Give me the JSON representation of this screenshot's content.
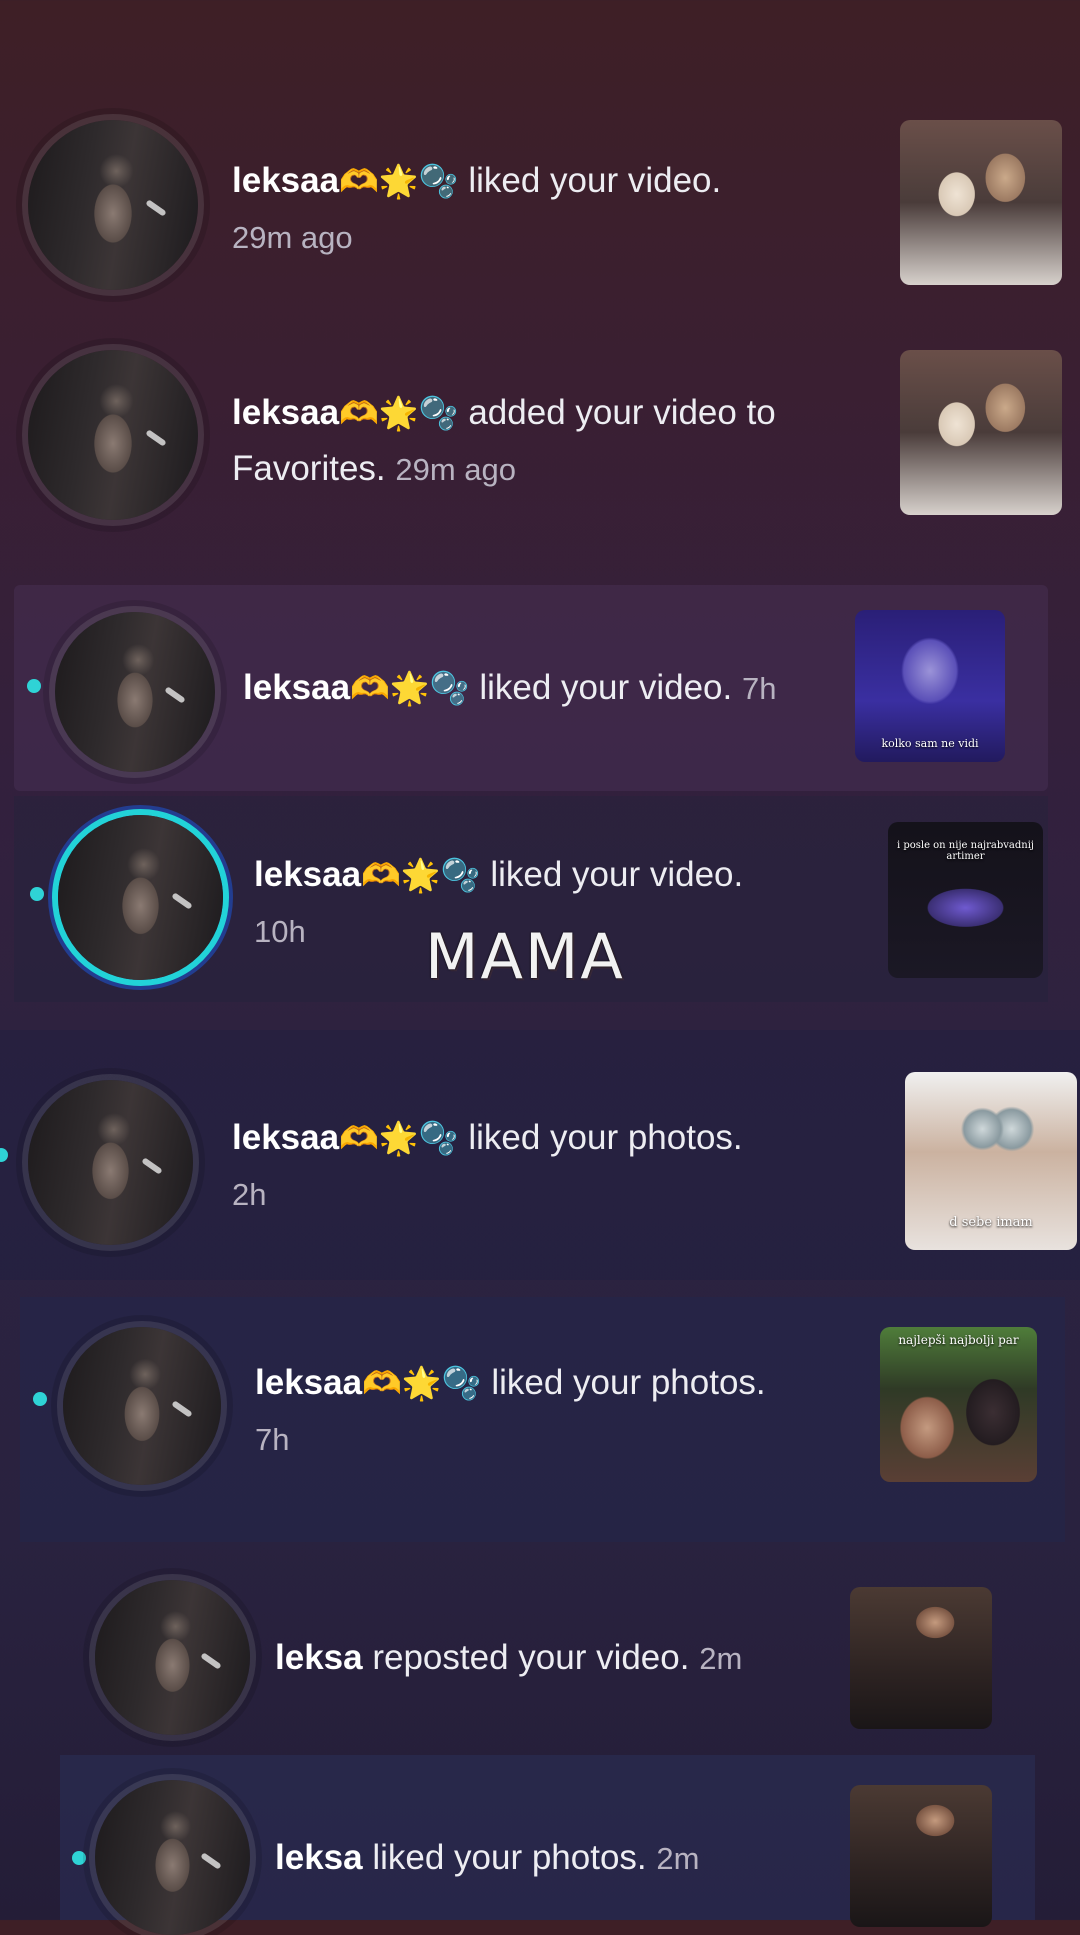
{
  "overlay_text": "MAMA",
  "notifications": [
    {
      "user": "leksaa",
      "emojis": "🫶🌟🫧",
      "action": "liked your video.",
      "time": "29m ago",
      "thumb_caption": ""
    },
    {
      "user": "leksaa",
      "emojis": "🫶🌟🫧",
      "action": "added your video to Favorites.",
      "time": "29m ago",
      "thumb_caption": ""
    },
    {
      "user": "leksaa",
      "emojis": "🫶🌟🫧",
      "action": "liked your video.",
      "time": "7h",
      "thumb_caption": "kolko sam ne vidi"
    },
    {
      "user": "leksaa",
      "emojis": "🫶🌟🫧",
      "action": "liked your video.",
      "time": "10h",
      "thumb_caption": "i posle on nije najrabvadnij artimer"
    },
    {
      "user": "leksaa",
      "emojis": "🫶🌟🫧",
      "action": "liked your photos.",
      "time": "2h",
      "thumb_caption": "d sebe imam"
    },
    {
      "user": "leksaa",
      "emojis": "🫶🌟🫧",
      "action": "liked your photos.",
      "time": "7h",
      "thumb_caption": "najlepši najbolji par"
    },
    {
      "user": "leksa",
      "emojis": "",
      "action": "reposted your video.",
      "time": "2m",
      "thumb_caption": ""
    },
    {
      "user": "leksa",
      "emojis": "",
      "action": "liked your photos.",
      "time": "2m",
      "thumb_caption": ""
    }
  ],
  "colors": {
    "unread_dot": "#2fd3d6",
    "story_ring": "#22d3d8"
  }
}
